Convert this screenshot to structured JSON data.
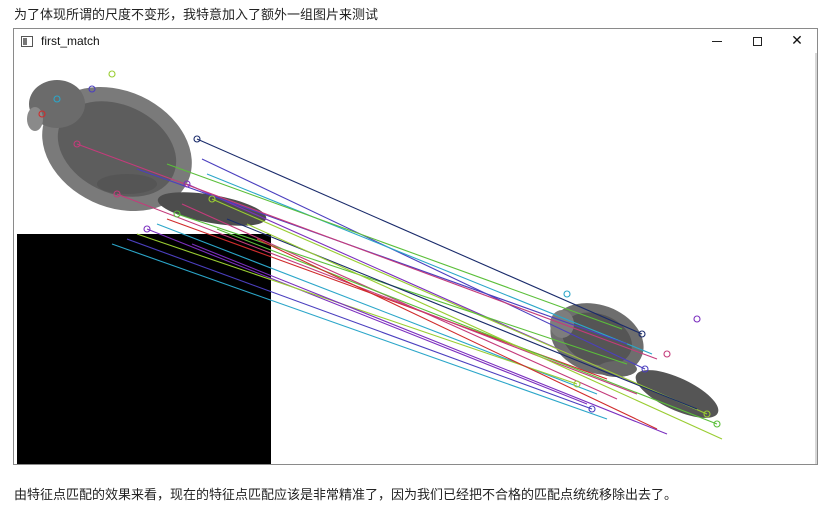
{
  "article": {
    "caption_top": "为了体现所谓的尺度不变形，我特意加入了额外一组图片来测试",
    "caption_bottom": "由特征点匹配的效果来看，现在的特征点匹配应该是非常精准了，因为我们已经把不合格的匹配点统统移除出去了。"
  },
  "window": {
    "title": "first_match",
    "app_icon": "opencv-window-icon",
    "controls": [
      {
        "name": "minimize",
        "icon": "minimize-icon"
      },
      {
        "name": "maximize",
        "icon": "maximize-icon"
      },
      {
        "name": "close",
        "icon": "close-icon",
        "glyph": "✕"
      }
    ]
  },
  "match_view": {
    "left_image": "beaver-large",
    "right_image": "beaver-small-rotated",
    "colors": {
      "background": "#ffffff",
      "black_region": "#000000",
      "line_colors": [
        "#1a2b6b",
        "#7b2fbf",
        "#5bbf3a",
        "#c43b7b",
        "#2ba6c9",
        "#9acd32",
        "#d02c2c",
        "#4b3fbf"
      ]
    }
  }
}
